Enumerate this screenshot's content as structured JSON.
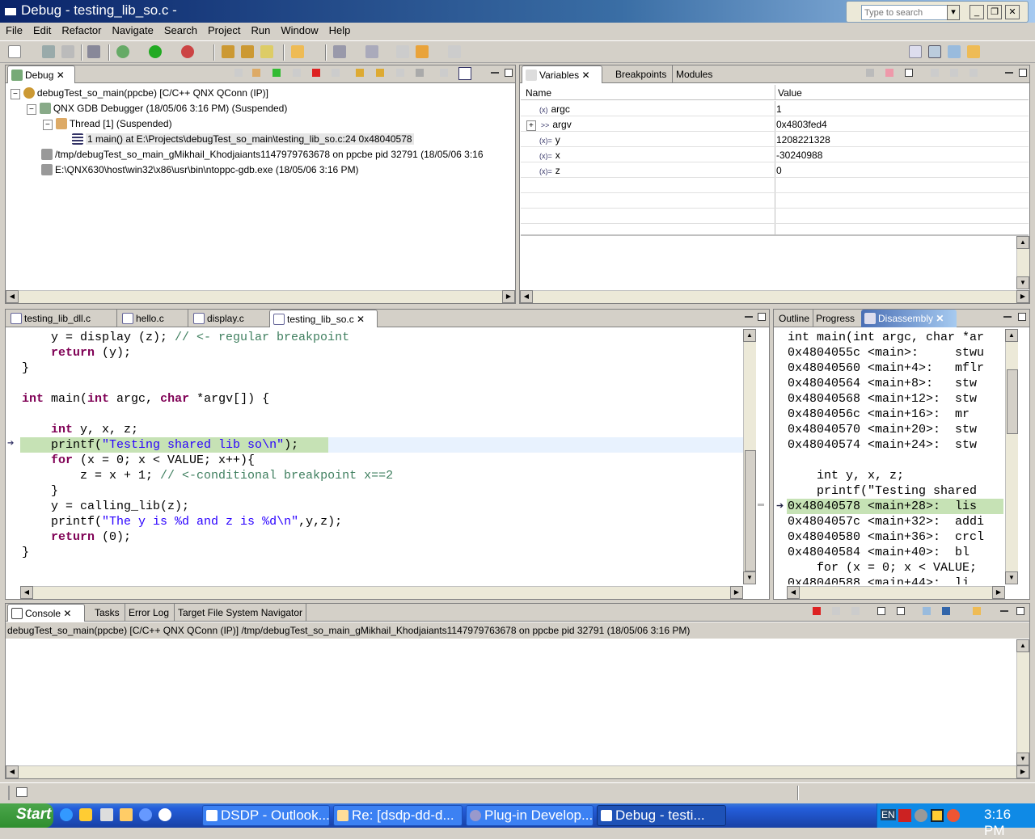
{
  "window": {
    "title": "Debug - testing_lib_so.c -",
    "search_placeholder": "Type to search"
  },
  "menu": [
    "File",
    "Edit",
    "Refactor",
    "Navigate",
    "Search",
    "Project",
    "Run",
    "Window",
    "Help"
  ],
  "debug_view": {
    "tab": "Debug",
    "items": [
      "debugTest_so_main(ppcbe) [C/C++ QNX QConn (IP)]",
      "QNX GDB Debugger (18/05/06 3:16 PM) (Suspended)",
      "Thread [1] (Suspended)",
      "1 main() at E:\\Projects\\debugTest_so_main\\testing_lib_so.c:24 0x48040578",
      "/tmp/debugTest_so_main_gMikhail_Khodjaiants1147979763678 on ppcbe pid 32791 (18/05/06 3:16",
      "E:\\QNX630\\host\\win32\\x86\\usr\\bin\\ntoppc-gdb.exe (18/05/06 3:16 PM)"
    ]
  },
  "variables_view": {
    "tabs": [
      "Variables",
      "Breakpoints",
      "Modules"
    ],
    "columns": [
      "Name",
      "Value"
    ],
    "rows": [
      {
        "name": "argc",
        "value": "1"
      },
      {
        "name": "argv",
        "value": "0x4803fed4"
      },
      {
        "name": "y",
        "value": "1208221328"
      },
      {
        "name": "x",
        "value": "-30240988"
      },
      {
        "name": "z",
        "value": "0"
      }
    ]
  },
  "editor": {
    "tabs": [
      "testing_lib_dll.c",
      "hello.c",
      "display.c",
      "testing_lib_so.c"
    ],
    "lines": [
      {
        "a": "    y = display (z); ",
        "c": "// <- regular breakpoint"
      },
      {
        "k": "    return",
        "a": " (y);"
      },
      {
        "a": "}"
      },
      {
        "a": ""
      },
      {
        "k": "int",
        "a": " main(",
        "k2": "int",
        "a2": " argc, ",
        "k3": "char",
        "a3": " *argv[]) {"
      },
      {
        "a": ""
      },
      {
        "k": "    int",
        "a": " y, x, z;"
      },
      {
        "a": "    printf(",
        "s": "\"Testing shared lib so\\n\"",
        "a2": ");"
      },
      {
        "k": "    for",
        "a": " (x = 0; x < VALUE; x++){"
      },
      {
        "a": "        z = x + 1; ",
        "c": "// <-conditional breakpoint x==2"
      },
      {
        "a": "    }"
      },
      {
        "a": "    y = calling_lib(z);"
      },
      {
        "a": "    printf(",
        "s": "\"The y is %d and z is %d\\n\"",
        "a2": ",y,z);"
      },
      {
        "k": "    return",
        "a": " (0);"
      },
      {
        "a": "}"
      }
    ]
  },
  "disassembly": {
    "tabs": [
      "Outline",
      "Progress",
      "Disassembly"
    ],
    "lines": [
      "int main(int argc, char *ar",
      "0x4804055c <main>:     stwu",
      "0x48040560 <main+4>:   mflr",
      "0x48040564 <main+8>:   stw",
      "0x48040568 <main+12>:  stw",
      "0x4804056c <main+16>:  mr",
      "0x48040570 <main+20>:  stw",
      "0x48040574 <main+24>:  stw",
      "",
      "    int y, x, z;",
      "    printf(\"Testing shared",
      "0x48040578 <main+28>:  lis",
      "0x4804057c <main+32>:  addi",
      "0x48040580 <main+36>:  crcl",
      "0x48040584 <main+40>:  bl",
      "    for (x = 0; x < VALUE;",
      "0x48040588 <main+44>:  li"
    ]
  },
  "console": {
    "tabs": [
      "Console",
      "Tasks",
      "Error Log",
      "Target File System Navigator"
    ],
    "header": "debugTest_so_main(ppcbe) [C/C++ QNX QConn (IP)] /tmp/debugTest_so_main_gMikhail_Khodjaiants1147979763678 on ppcbe pid 32791 (18/05/06 3:16 PM)"
  },
  "taskbar": {
    "start": "Start",
    "tasks": [
      "DSDP - Outlook...",
      "Re: [dsdp-dd-d...",
      "Plug-in Develop...",
      "Debug - testi..."
    ],
    "clock": "3:16 PM",
    "lang": "EN"
  }
}
